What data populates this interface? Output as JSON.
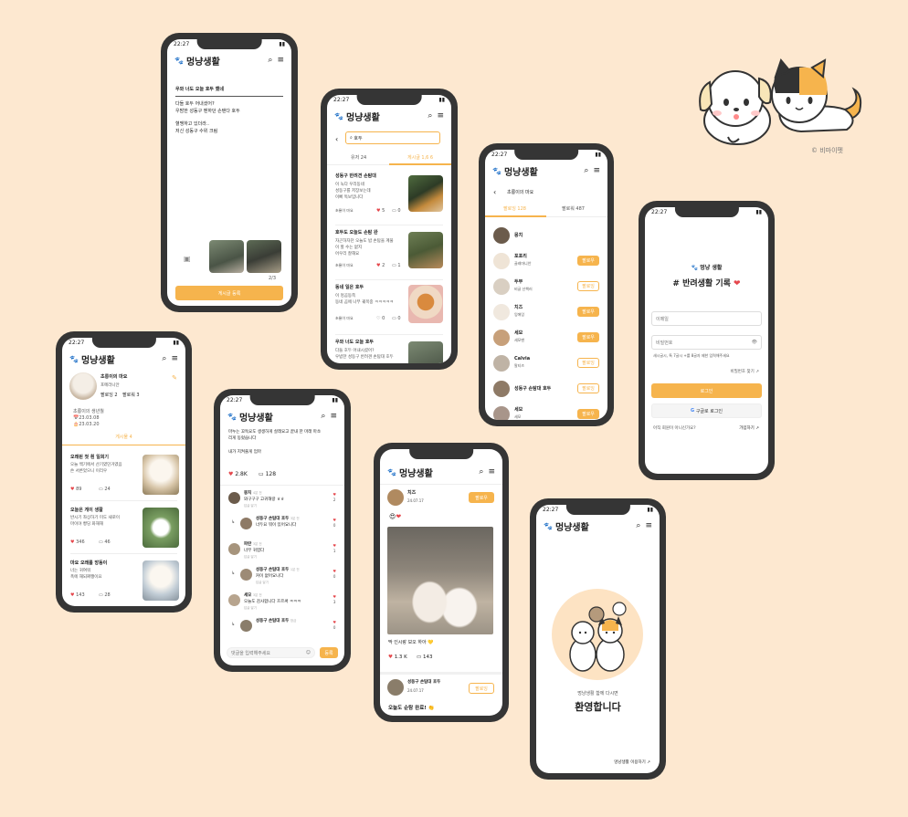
{
  "time": "22:27",
  "brand": "멍냥생활",
  "colors": {
    "accent": "#f6b44d",
    "background": "#fde8d0",
    "frame": "#353535"
  },
  "icons": {
    "search": "search-icon",
    "menu": "hamburger-menu-icon",
    "paw": "paw-icon",
    "heart": "heart-icon",
    "comment": "comment-icon",
    "image": "image-icon",
    "back": "back-arrow-icon"
  },
  "write": {
    "line1": "우와 너도 오늘 호두 했네",
    "line2": "다들 호두 어내셨어?",
    "line3": "우밤한 성동구 멘하던 손탠다 호두",
    "line4": "혈맹하고 있더라..",
    "line5": "저신 성동구 수위 크림",
    "count": "2/3",
    "submit": "게시글 등록"
  },
  "search": {
    "query": "호두",
    "tab1": "유저 24",
    "tab2": "게시글 1,6 6",
    "posts": [
      {
        "title": "성동구 반려견 손탐대",
        "body": "이 녹다 우리동네\n성동구를 저장보는데\n이뻐 독보임니다",
        "likes": "5",
        "comments": "0"
      },
      {
        "title": "호두도 오늘도 손탐 완",
        "body": "자곤하자던 오늘도 밤 손탐을 계물\n이 할 수는 없지\n어우리 잘해요\n",
        "likes": "2",
        "comments": "1"
      },
      {
        "title": "동네 일은 호두",
        "body": "이 멍곰동쪽\n동네 곰에 나무 궤목중 ㅋㅋㅋㅋㅋ",
        "likes": "0",
        "comments": "0"
      },
      {
        "title": "우와 너도 오늘 호두",
        "body": "다들 호두 어내시셨어?\n우밤한 성동구 반려견 손탐대 호두",
        "likes": "",
        "comments": ""
      }
    ],
    "author": "초롱이 마요"
  },
  "follow": {
    "title": "초롱이의 마요",
    "tab1": "팔로잉 128",
    "tab2": "팔로워 487",
    "users": [
      {
        "name": "뭉치",
        "sub": ""
      },
      {
        "name": "포포리",
        "sub": "골레마니안",
        "btn": "팔로우"
      },
      {
        "name": "두부",
        "sub": "비글 산책러",
        "btn": "팔로잉"
      },
      {
        "name": "치즈",
        "sub": "잉애잉",
        "btn": "팔로우"
      },
      {
        "name": "세모",
        "sub": "세모맨",
        "btn": "팔로우"
      },
      {
        "name": "Calvia",
        "sub": "말티즈",
        "btn": "팔로잉"
      },
      {
        "name": "성동구 손탐대 호두",
        "sub": "",
        "btn": "팔로잉"
      },
      {
        "name": "세모",
        "sub": "세모",
        "btn": "팔로우"
      }
    ]
  },
  "login": {
    "brand": "멍냥 생활",
    "headline": "# 반려생활 기록",
    "email_ph": "이메일",
    "pw_ph": "비밀번호",
    "error": "새시글시, 특 7글시 +를 8글자 제한 입력해주세요",
    "find": "비밀번호 찾기",
    "login": "로그인",
    "google": "구글로 로그인",
    "q": "아직 회원이 아니신가요?",
    "signup": "가입하기"
  },
  "profile": {
    "name": "초롱이의 마요",
    "sub": "포메라니안",
    "following": "팔로잉 2",
    "follower": "팔로워 3",
    "bio1": "초롱이의 생년월",
    "birth1": "23.03.08",
    "birth2": "23.03.20",
    "tab": "게시물 4",
    "posts": [
      {
        "title": "오래된 첫 흰 일회기",
        "body": "오늘 백기에서 산기였던거였음\n쓴 서른었으니 이리우",
        "likes": "89",
        "comments": "24"
      },
      {
        "title": "오늘은 게이 생활",
        "body": "반시기 좌상하기 미도 새로이\n마이야 빵딩 화해해",
        "likes": "346",
        "comments": "46"
      },
      {
        "title": "마요 오래를 방동이",
        "body": "너는 귀여워\n폭에 재되쩌쨍이요",
        "likes": "143",
        "comments": "28"
      }
    ]
  },
  "comments": {
    "post": "마누는 꼬독요도 생생하게 살래요고 끝내 한 마래 마쏘\n리게 동렀습니다",
    "post2": "내가 지켜줄게 엄마",
    "likes": "2.8K",
    "count": "128",
    "items": [
      {
        "name": "뭉치",
        "time": "4분 전",
        "text": "와구구구 고귀해랑 ㅎㅎ",
        "reply": "답글 달기",
        "lv": 0,
        "n": "2"
      },
      {
        "name": "성동구 손탐대 호두",
        "time": "3분 전",
        "text": "너두요 뭐이 있어요니다",
        "reply": "",
        "lv": 1,
        "n": "0"
      },
      {
        "name": "파란",
        "time": "3분 전",
        "text": "너무 귀엽다",
        "reply": "답글 달기",
        "lv": 0,
        "n": "1"
      },
      {
        "name": "성동구 손탐대 호두",
        "time": "1분 전",
        "text": "커이 없어요니다",
        "reply": "답글 달기",
        "lv": 1,
        "n": "0"
      },
      {
        "name": "세모",
        "time": "3분 전",
        "text": "오늘도 감사합니다 흐르써 ㅋㅋㅋ",
        "reply": "답글 달기",
        "lv": 0,
        "n": "3"
      },
      {
        "name": "성동구 손탐대 호두",
        "time": "방금",
        "text": "",
        "reply": "",
        "lv": 1,
        "n": "0"
      }
    ],
    "input_ph": "댓글을 입력해주세요",
    "send": "등록"
  },
  "feed": {
    "user": "치즈",
    "date": "24.07.17",
    "follow": "팔로우",
    "caption": "딱 인시랑 보오 하아",
    "likes": "1.3 K",
    "comments": "143",
    "user2": "성동구 손탐대 호두",
    "date2": "24.07.17",
    "follow2": "팔로잉",
    "caption2": "오늘도 순탐 완료!"
  },
  "welcome": {
    "sub": "멍냥생활 함께 다시면",
    "title": "환영합니다",
    "link": "멍냥생활 이용하기"
  },
  "credit": "© 비마이펫"
}
